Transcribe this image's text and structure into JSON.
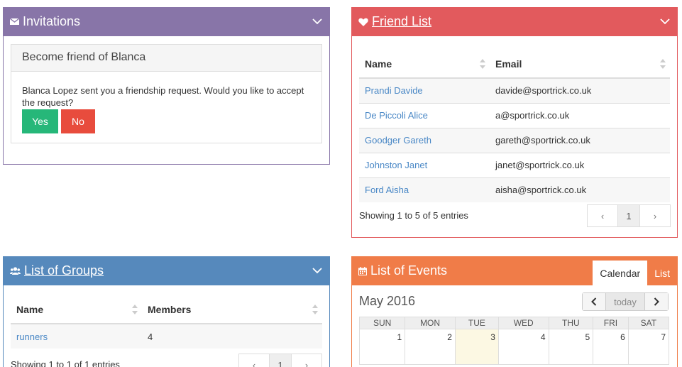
{
  "invitations": {
    "title": "Invitations",
    "box_title": "Become friend of Blanca",
    "message": "Blanca Lopez sent you a friendship request. Would you like to accept the request?",
    "yes_label": "Yes",
    "no_label": "No",
    "color": "#8875a8"
  },
  "friends": {
    "title": "Friend List",
    "color": "#e25a5d",
    "columns": [
      "Name",
      "Email"
    ],
    "rows": [
      {
        "name": "Prandi Davide",
        "email": "davide@sportrick.co.uk"
      },
      {
        "name": "De Piccoli Alice",
        "email": "a@sportrick.co.uk"
      },
      {
        "name": "Goodger Gareth",
        "email": "gareth@sportrick.co.uk"
      },
      {
        "name": "Johnston Janet",
        "email": "janet@sportrick.co.uk"
      },
      {
        "name": "Ford Aisha",
        "email": "aisha@sportrick.co.uk"
      }
    ],
    "info": "Showing 1 to 5 of 5 entries",
    "pager": {
      "prev": "‹",
      "page": "1",
      "next": "›"
    }
  },
  "groups": {
    "title": "List of Groups",
    "color": "#5689bc",
    "columns": [
      "Name",
      "Members"
    ],
    "rows": [
      {
        "name": "runners",
        "members": "4"
      }
    ],
    "info": "Showing 1 to 1 of 1 entries",
    "pager": {
      "prev": "‹",
      "page": "1",
      "next": "›"
    }
  },
  "events": {
    "title": "List of Events",
    "color": "#f07c48",
    "tabs": [
      "Calendar",
      "List"
    ],
    "month": "May 2016",
    "nav": {
      "prev": "‹",
      "today": "today",
      "next": "›"
    },
    "weekdays": [
      "SUN",
      "MON",
      "TUE",
      "WED",
      "THU",
      "FRI",
      "SAT"
    ],
    "first_week": [
      "1",
      "2",
      "3",
      "4",
      "5",
      "6",
      "7"
    ],
    "today_day": "3"
  }
}
